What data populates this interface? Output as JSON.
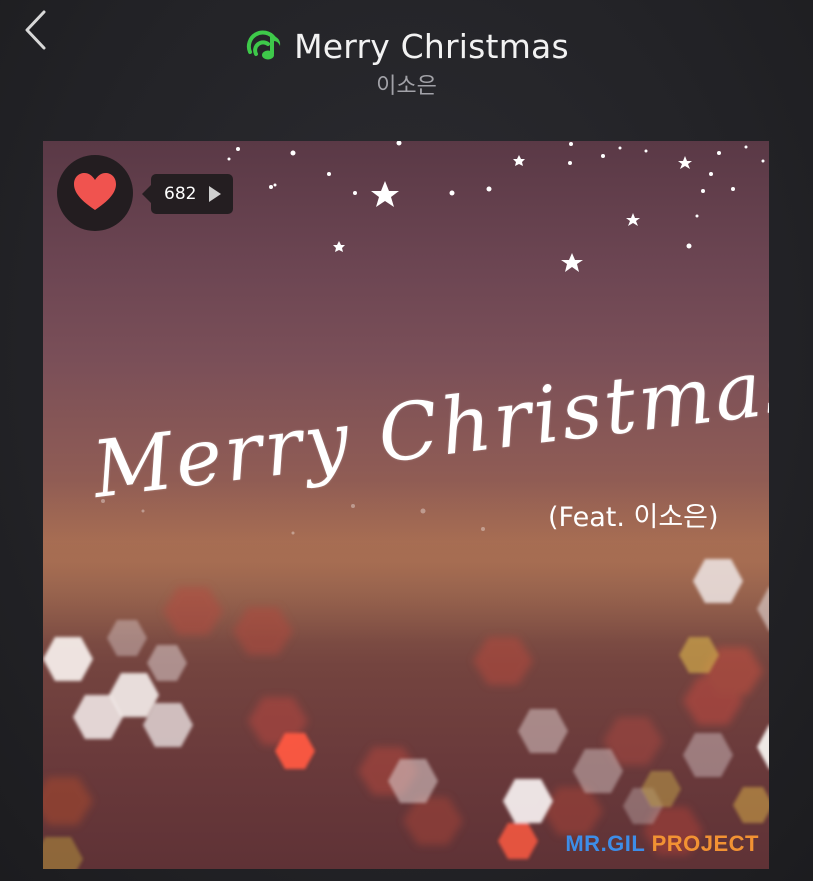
{
  "header": {
    "back_icon": "chevron-left-icon",
    "music_icon": "music-note-icon",
    "title": "Merry Christmas",
    "artist": "이소은"
  },
  "album": {
    "title_art": "Merry Christmas",
    "feat": "(Feat. 이소은)",
    "brand_part1": "MR.GIL",
    "brand_part2": "PROJECT",
    "brand_colors": {
      "part1": "#3d8de8",
      "part2": "#f29233"
    }
  },
  "like": {
    "icon": "heart-icon",
    "count": "682",
    "arrow_icon": "play-arrow-icon",
    "heart_color": "#f0534f"
  },
  "colors": {
    "accent": "#3ec94a",
    "background": "#262629"
  }
}
